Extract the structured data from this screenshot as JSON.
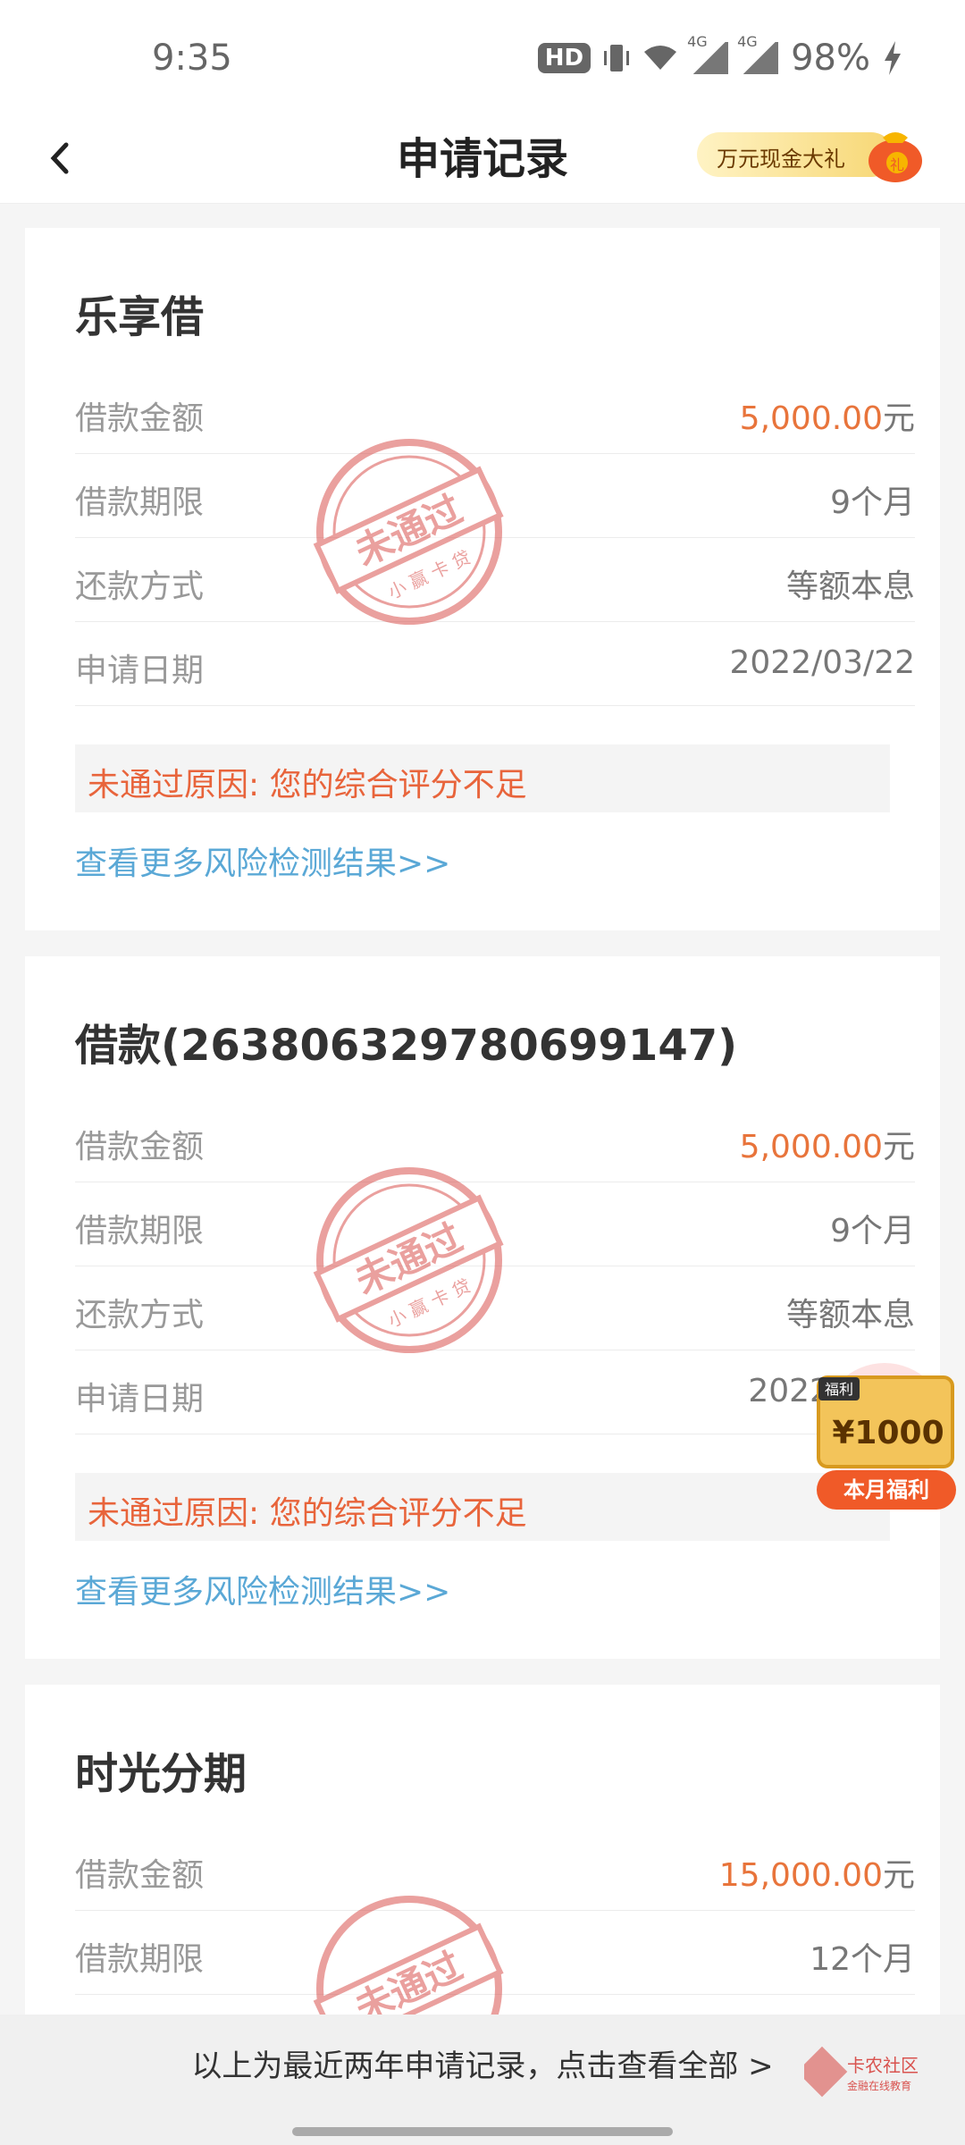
{
  "status_bar": {
    "time": "9:35",
    "hd": "HD",
    "net1": "4G",
    "net2": "4G",
    "battery": "98%"
  },
  "header": {
    "title": "申请记录",
    "promo_text": "万元现金大礼",
    "promo_badge": "礼"
  },
  "cards": [
    {
      "title": "乐享借",
      "amount_label": "借款金额",
      "amount_value": "5,000.00",
      "amount_unit": "元",
      "term_label": "借款期限",
      "term_value": "9个月",
      "method_label": "还款方式",
      "method_value": "等额本息",
      "date_label": "申请日期",
      "date_value": "2022/03/22",
      "reason": "未通过原因: 您的综合评分不足",
      "link": "查看更多风险检测结果>>",
      "stamp_text": "未通过",
      "stamp_sub": "小 赢 卡 贷"
    },
    {
      "title": "借款(263806329780699147)",
      "amount_label": "借款金额",
      "amount_value": "5,000.00",
      "amount_unit": "元",
      "term_label": "借款期限",
      "term_value": "9个月",
      "method_label": "还款方式",
      "method_value": "等额本息",
      "date_label": "申请日期",
      "date_value": "2022/0",
      "reason": "未通过原因: 您的综合评分不足",
      "link": "查看更多风险检测结果>>",
      "stamp_text": "未通过",
      "stamp_sub": "小 赢 卡 贷"
    },
    {
      "title": "时光分期",
      "amount_label": "借款金额",
      "amount_value": "15,000.00",
      "amount_unit": "元",
      "term_label": "借款期限",
      "term_value": "12个月",
      "stamp_text": "未通过"
    }
  ],
  "float_widget": {
    "tag": "福利",
    "amount": "¥1000",
    "button": "本月福利"
  },
  "bottom": {
    "text": "以上为最近两年申请记录，点击查看全部 >",
    "watermark_title": "卡农社区",
    "watermark_sub": "金融在线教育"
  },
  "colors": {
    "accent_orange": "#e8743b",
    "link_blue": "#5aa8d6",
    "stamp_red": "#d9534f"
  }
}
